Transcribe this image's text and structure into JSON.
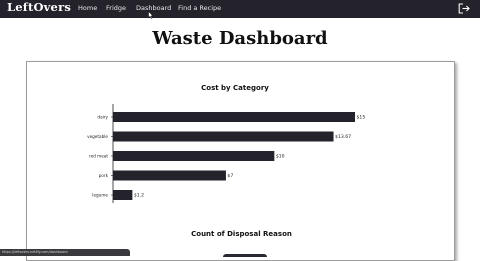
{
  "navbar": {
    "brand": "LeftOvers",
    "links": [
      "Home",
      "Fridge",
      "Dashboard",
      "Find a Recipe"
    ],
    "logout_icon": "logout-icon"
  },
  "page": {
    "title": "Waste Dashboard"
  },
  "chart_data": [
    {
      "type": "bar",
      "orientation": "horizontal",
      "title": "Cost by Category",
      "categories": [
        "dairy",
        "vegetable",
        "red meat",
        "pork",
        "legume"
      ],
      "values": [
        15,
        13.67,
        10,
        7,
        1.2
      ],
      "value_labels": [
        "$15",
        "$13.67",
        "$10",
        "$7",
        "$1.2"
      ],
      "bar_color": "#24222a",
      "xlim": [
        0,
        15
      ]
    },
    {
      "type": "pie",
      "title": "Count of Disposal Reason"
    }
  ],
  "statusbar": {
    "text": "https://leftovers.netlify.com/dashboard"
  },
  "colors": {
    "nav_bg": "#24222a",
    "bar": "#24222a"
  }
}
